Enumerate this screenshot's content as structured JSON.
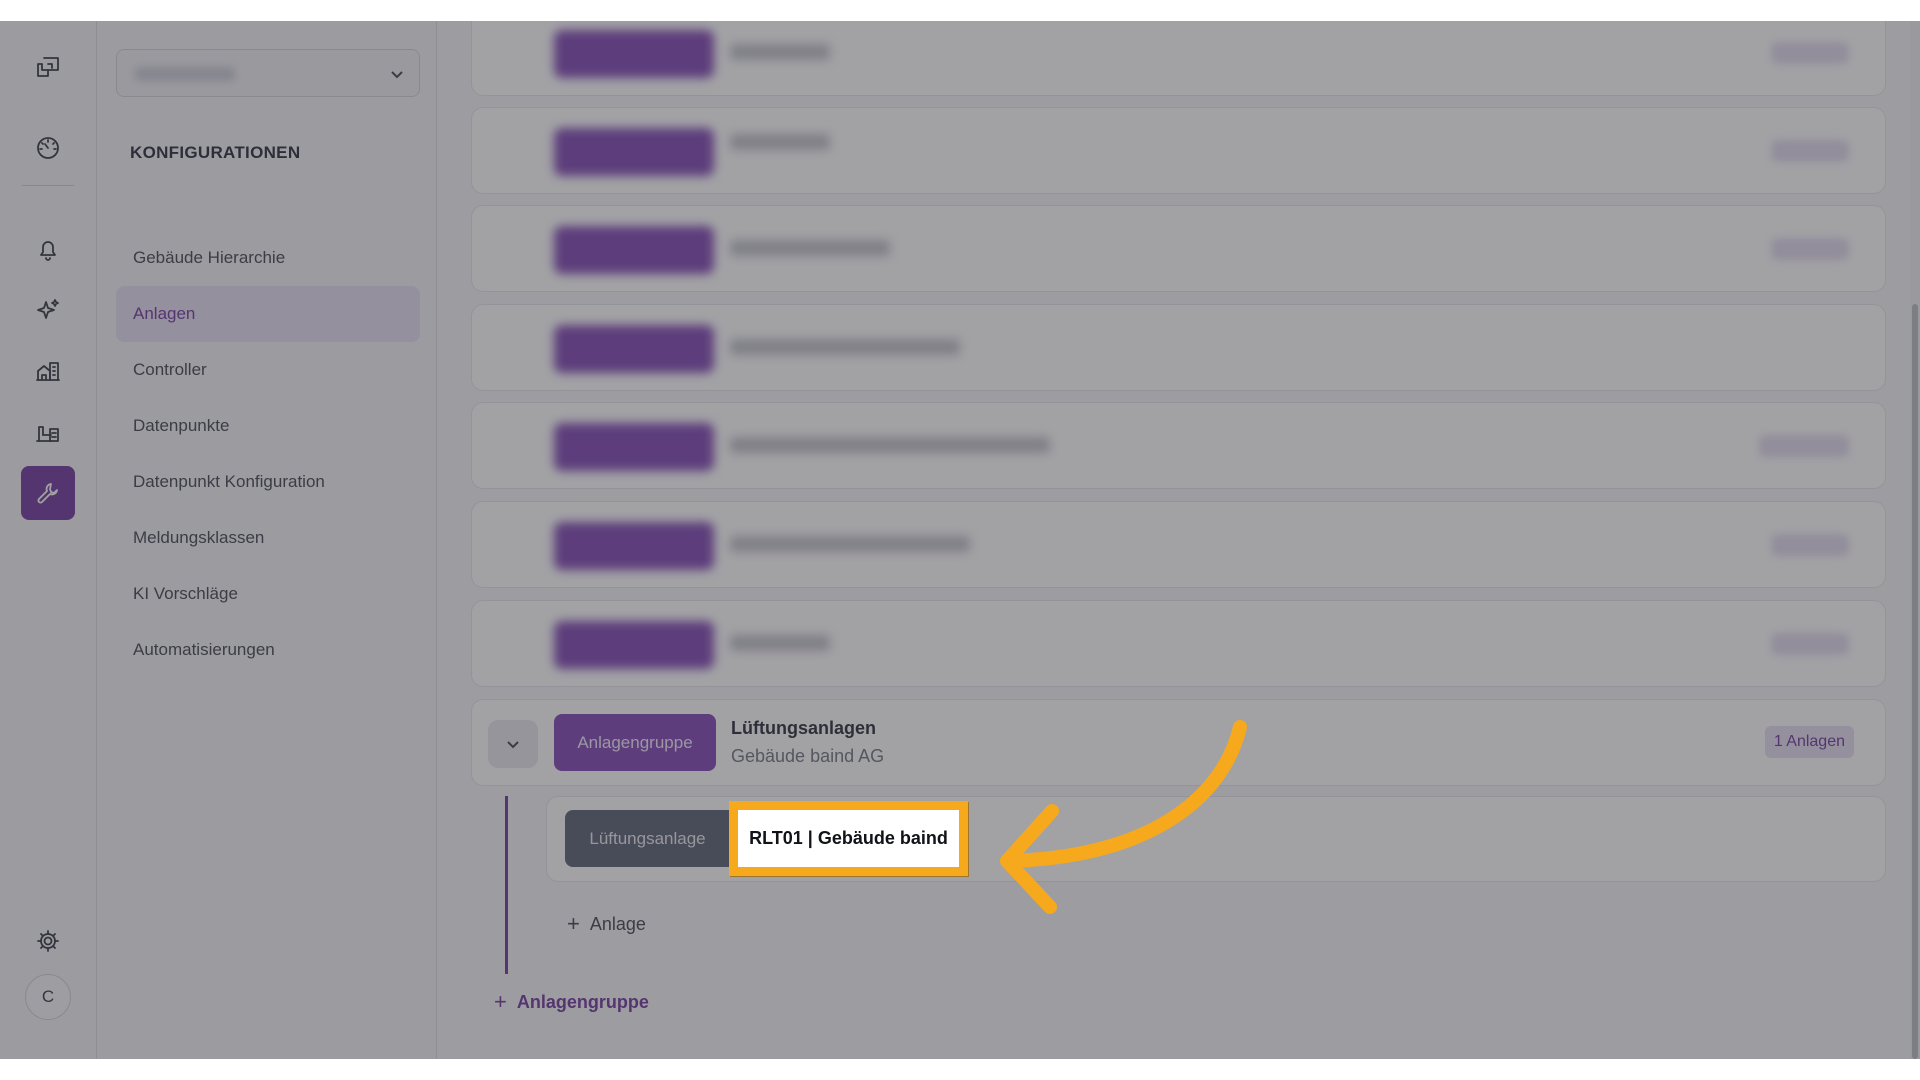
{
  "rail": {
    "icons": [
      "logo-icon",
      "dashboard-gauge-icon",
      "bell-icon",
      "sparkles-icon",
      "buildings-icon",
      "plant-icon",
      "wrench-icon",
      "gear-icon"
    ],
    "avatar_initial": "C",
    "active": "wrench-icon",
    "accent": "#6a2f9a"
  },
  "sidebar": {
    "select_value": "",
    "title": "KONFIGURATIONEN",
    "items": [
      {
        "label": "Gebäude Hierarchie"
      },
      {
        "label": "Anlagen"
      },
      {
        "label": "Controller"
      },
      {
        "label": "Datenpunkte"
      },
      {
        "label": "Datenpunkt Konfiguration"
      },
      {
        "label": "Meldungsklassen"
      },
      {
        "label": "KI Vorschläge"
      },
      {
        "label": "Automatisierungen"
      }
    ],
    "active_index": 1
  },
  "main": {
    "group": {
      "type_label": "Anlagengruppe",
      "title": "Lüftungsanlagen",
      "subtitle": "Gebäude baind AG",
      "count_badge": "1 Anlagen"
    },
    "anlage": {
      "type_label": "Lüftungsanlage",
      "name": "RLT01 | Gebäude baind"
    },
    "add_anlage_label": "Anlage",
    "add_group_label": "Anlagengruppe"
  },
  "colors": {
    "highlight": "#f6a91c",
    "pill_purple": "#7b3fb0",
    "pill_slate": "#545a6e"
  }
}
